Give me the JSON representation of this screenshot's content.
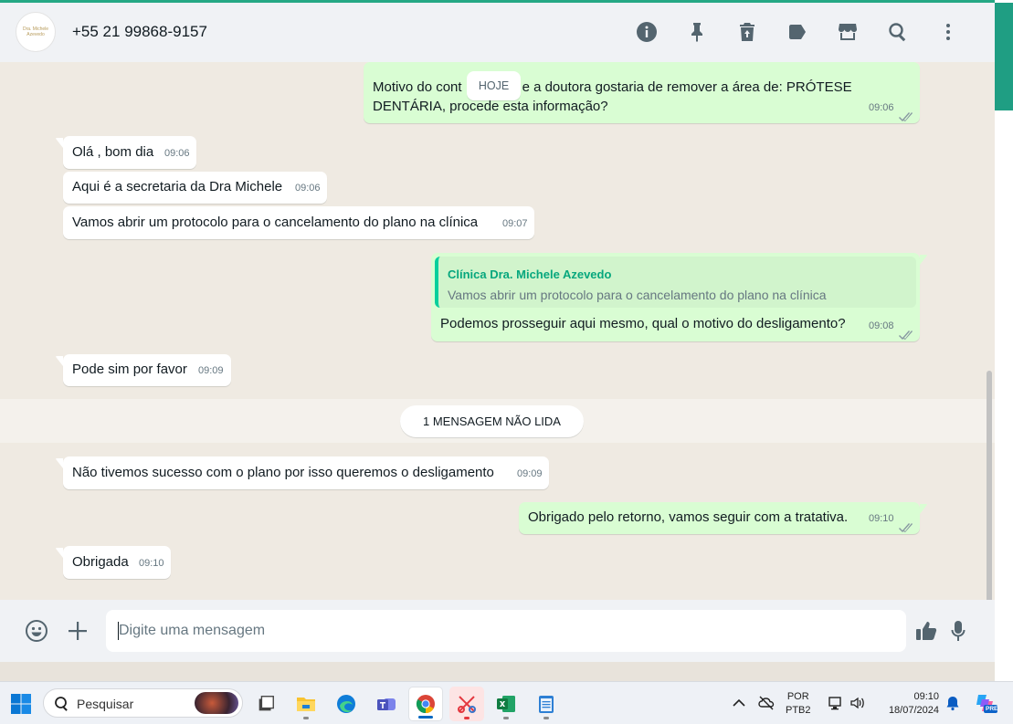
{
  "header": {
    "contact_name": "+55 21 99868-9157",
    "avatar_text": "Dra. Michele Azevedo",
    "icons": [
      "info-icon",
      "pin-icon",
      "delete-icon",
      "label-icon",
      "catalog-store-icon",
      "search-icon",
      "menu-dots-icon"
    ]
  },
  "chat": {
    "date_chip": "HOJE",
    "unread_chip": "1 MENSAGEM NÃO LIDA",
    "messages": [
      {
        "dir": "out",
        "text_line1": "Motivo do cont",
        "text_line1b": "e a doutora gostaria de remover a área de: PRÓTESE",
        "text_line2": "DENTÁRIA, procede esta informação?",
        "time": "09:06"
      },
      {
        "dir": "in",
        "text": "Olá , bom dia",
        "time": "09:06"
      },
      {
        "dir": "in",
        "text": "Aqui é a secretaria da Dra Michele",
        "time": "09:06"
      },
      {
        "dir": "in",
        "text": "Vamos abrir um protocolo para o cancelamento do plano na clínica",
        "time": "09:07"
      },
      {
        "dir": "out",
        "quote_name": "Clínica Dra. Michele Azevedo",
        "quote_text": "Vamos abrir um protocolo para o cancelamento do plano na clínica",
        "text": "Podemos prosseguir aqui mesmo, qual o motivo do desligamento?",
        "time": "09:08"
      },
      {
        "dir": "in",
        "text": "Pode sim por favor",
        "time": "09:09"
      },
      {
        "dir": "in",
        "text": "Não tivemos sucesso com o plano por isso queremos o desligamento",
        "time": "09:09"
      },
      {
        "dir": "out",
        "text": "Obrigado pelo retorno, vamos seguir com a tratativa.",
        "time": "09:10"
      },
      {
        "dir": "in",
        "text": "Obrigada",
        "time": "09:10"
      }
    ]
  },
  "composer": {
    "placeholder": "Digite uma mensagem",
    "icons": [
      "emoji-icon",
      "attach-plus-icon",
      "thumbs-up-icon",
      "microphone-icon"
    ]
  },
  "taskbar": {
    "search_label": "Pesquisar",
    "language": "POR",
    "keyboard": "PTB2",
    "time": "09:10",
    "date": "18/07/2024",
    "copilot_badge": "PRE"
  },
  "colors": {
    "accent": "#25a884",
    "outgoing_bubble": "#d9fdd3",
    "incoming_bubble": "#ffffff",
    "chat_bg": "#efeae2",
    "quote_name": "#06a77d"
  }
}
